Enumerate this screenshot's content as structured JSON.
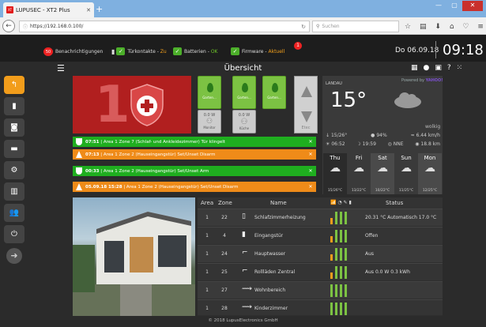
{
  "browser": {
    "tab_title": "LUPUSEC - XT2 Plus",
    "favicon_text": "XT",
    "url": "https://192.168.0.100/",
    "search_placeholder": "Suchen"
  },
  "status": {
    "notif_count": "50",
    "notif_label": "Benachrichtigungen",
    "door_label": "Türkontakte -",
    "door_state": "Zu",
    "battery_label": "Batterien -",
    "battery_state": "OK",
    "fw_label": "Firmware -",
    "fw_state": "Aktuell",
    "fw_badge": "1",
    "date": "Do 06.09.18",
    "time": "09:18"
  },
  "header": {
    "title": "Übersicht"
  },
  "alarm": {
    "area": "1"
  },
  "switches": [
    {
      "label": "Garten..."
    },
    {
      "label": "Garten..."
    },
    {
      "label": "Garten..."
    }
  ],
  "monitor": {
    "value": "0.0 W",
    "label": "Monitor"
  },
  "kueche": {
    "value": "0.0 W",
    "label": "Küche"
  },
  "blinds": {
    "label": "Etec"
  },
  "weather": {
    "city": "LANDAU",
    "powered": "Powered by",
    "brand": "YAHOO!",
    "temp": "15°",
    "desc": "wolkig",
    "range": "15/26°",
    "humidity": "94%",
    "wind": "6.44 km/h",
    "sunrise": "06:52",
    "sunset": "19:59",
    "direction": "NNE",
    "visibility": "18.8 km",
    "forecast": [
      {
        "day": "Thu",
        "temp": "15/26°C"
      },
      {
        "day": "Fri",
        "temp": "13/22°C"
      },
      {
        "day": "Sat",
        "temp": "10/22°C"
      },
      {
        "day": "Sun",
        "temp": "11/25°C"
      },
      {
        "day": "Mon",
        "temp": "12/25°C"
      }
    ]
  },
  "events": [
    {
      "time": "07:51",
      "text": "| Area 1 Zone 7 (Schlaf- und Ankleidezimmer) Tür klingelt",
      "type": "g"
    },
    {
      "time": "07:13",
      "text": "| Area 1 Zone 2 (Hauseingangstür) Set/Unset Disarm",
      "type": "o"
    },
    {
      "time": "00:33",
      "text": "| Area 1 Zone 2 (Hauseingangstür) Set/Unset Arm",
      "type": "g"
    },
    {
      "time": "05.09.18 15:28",
      "text": "| Area 1 Zone 2 (Hauseingangstür) Set/Unset Disarm",
      "type": "o"
    }
  ],
  "table": {
    "headers": {
      "area": "Area",
      "zone": "Zone",
      "name": "Name",
      "status": "Status"
    },
    "rows": [
      {
        "area": "1",
        "zone": "22",
        "name": "Schlafzimmerheizung",
        "status": "20.31 °C Automatisch 17.0 °C",
        "icon": "thermostat-icon"
      },
      {
        "area": "1",
        "zone": "4",
        "name": "Eingangstür",
        "status": "Offen",
        "icon": "door-icon"
      },
      {
        "area": "1",
        "zone": "24",
        "name": "Hauptwasser",
        "status": "Aus",
        "icon": "valve-icon"
      },
      {
        "area": "1",
        "zone": "25",
        "name": "Rollläden Zentral",
        "status": "Aus 0.0 W 0.3 kWh",
        "icon": "blinds-icon"
      },
      {
        "area": "1",
        "zone": "27",
        "name": "Wohnbereich",
        "status": "",
        "icon": "light-icon"
      },
      {
        "area": "1",
        "zone": "28",
        "name": "Kinderzimmer",
        "status": "",
        "icon": "light-icon"
      }
    ]
  },
  "footer": "© 2018 LupusElectronics GmbH",
  "colors": {
    "alarm_red": "#b11f1f",
    "green": "#1fae1f",
    "orange": "#ef8b19",
    "accent": "#f29d1b"
  }
}
